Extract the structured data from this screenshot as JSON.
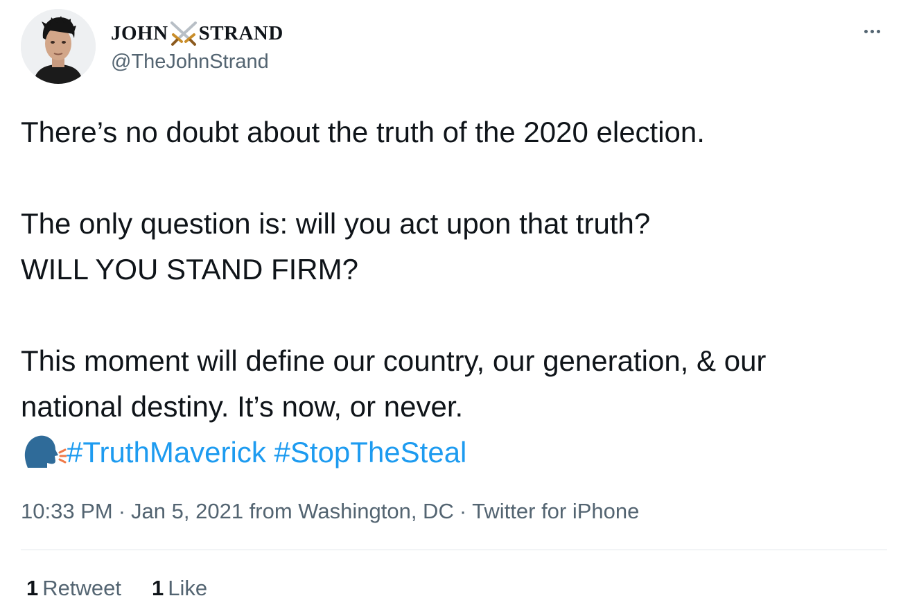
{
  "author": {
    "name_first": "JOHN",
    "name_last": "STRAND",
    "name_emoji": "crossed-swords-icon",
    "handle": "@TheJohnStrand"
  },
  "tweet": {
    "lines": [
      "There’s no doubt about the truth of the 2020 election.",
      "",
      "The only question is: will you act upon that truth?",
      "WILL YOU STAND FIRM?",
      "",
      "This moment will define our country, our generation, & our",
      "national destiny. It’s now, or never."
    ],
    "hashtag_icon": "speaking-head-icon",
    "hashtags": [
      "#TruthMaverick",
      "#StopTheSteal"
    ]
  },
  "meta": {
    "time": "10:33 PM",
    "separator": "·",
    "date_location": "Jan 5, 2021 from Washington, DC",
    "source": "Twitter for iPhone"
  },
  "stats": {
    "retweets_count": "1",
    "retweets_label": "Retweet",
    "likes_count": "1",
    "likes_label": "Like"
  },
  "colors": {
    "text": "#0f1419",
    "secondary": "#536471",
    "link": "#1d9bf0",
    "divider": "#e1e5e9"
  }
}
